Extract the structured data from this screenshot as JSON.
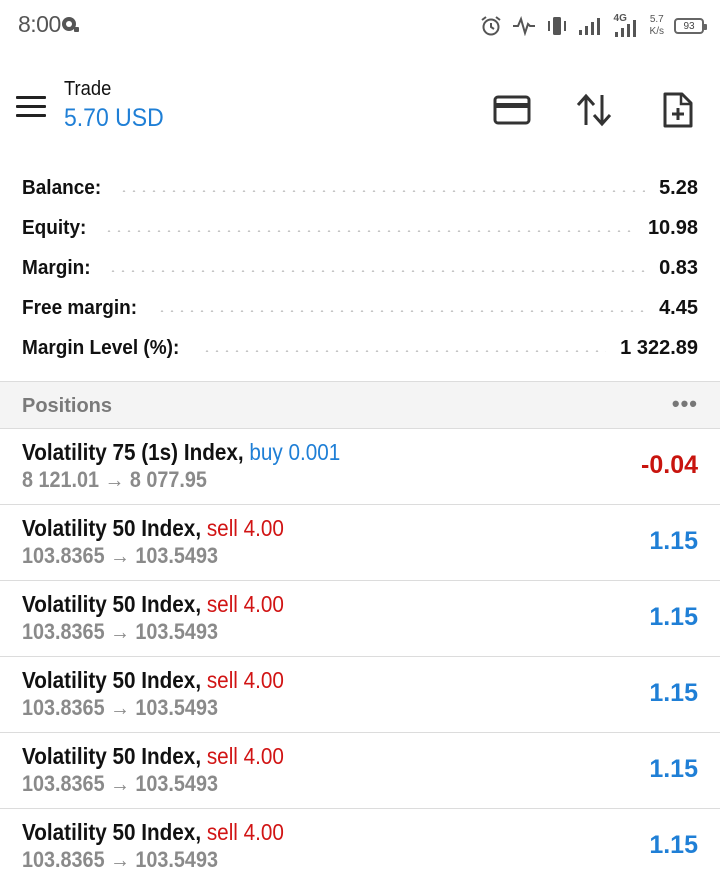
{
  "status_bar": {
    "time": "8:00",
    "network": "4G",
    "speed_value": "5.7",
    "speed_unit": "K/s",
    "battery": "93"
  },
  "toolbar": {
    "title": "Trade",
    "subtitle": "5.70 USD"
  },
  "summary": [
    {
      "label": "Balance:",
      "value": "5.28"
    },
    {
      "label": "Equity:",
      "value": "10.98"
    },
    {
      "label": "Margin:",
      "value": "0.83"
    },
    {
      "label": "Free margin:",
      "value": "4.45"
    },
    {
      "label": "Margin Level (%):",
      "value": "1 322.89"
    }
  ],
  "positions": {
    "header": "Positions",
    "more": "•••",
    "rows": [
      {
        "symbol": "Volatility 75 (1s) Index,",
        "side": "buy 0.001",
        "prices": "8 121.01 → 8 077.95",
        "profit": "-0.04"
      },
      {
        "symbol": "Volatility 50 Index,",
        "side": "sell 4.00",
        "prices": "103.8365 → 103.5493",
        "profit": "1.15"
      },
      {
        "symbol": "Volatility 50 Index,",
        "side": "sell 4.00",
        "prices": "103.8365 → 103.5493",
        "profit": "1.15"
      },
      {
        "symbol": "Volatility 50 Index,",
        "side": "sell 4.00",
        "prices": "103.8365 → 103.5493",
        "profit": "1.15"
      },
      {
        "symbol": "Volatility 50 Index,",
        "side": "sell 4.00",
        "prices": "103.8365 → 103.5493",
        "profit": "1.15"
      },
      {
        "symbol": "Volatility 50 Index,",
        "side": "sell 4.00",
        "prices": "103.8365 → 103.5493",
        "profit": "1.15"
      }
    ]
  },
  "colors": {
    "accent_blue": "#1f7fd6",
    "loss_red": "#c8140e",
    "sell_red": "#d11414"
  }
}
